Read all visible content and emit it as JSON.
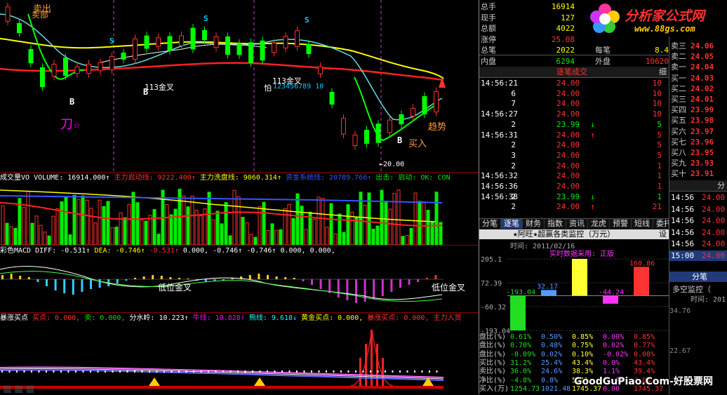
{
  "main_chart": {
    "labels": {
      "top_sell": "卖出",
      "top_sell2": "卖部",
      "knife": "刀☆",
      "jincha1": "113金叉",
      "jincha2": "113金叉",
      "buy1": "B",
      "buy2": "B",
      "buy3": "B",
      "sell1": "S",
      "sell2": "S",
      "sell3": "S",
      "buy_in": "买入",
      "trend": "趋势",
      "low_mark": "←20.00",
      "seq": "123456789 10",
      "pa": "怕"
    }
  },
  "volume_header": {
    "name": "成交量VO",
    "volume": "VOLUME: 16914.000↑",
    "start": "主力启动线: 9222.400↑",
    "wash": "主力洗盘线: 9060.314↑",
    "sys": "资金系统线: 20789.766↑",
    "out": "出击: 启动: OK: CON"
  },
  "macd_header": {
    "name": "彩色MACD",
    "diff": "DIFF: -0.531↑",
    "dea": "DEA: -0.746↑",
    "v1": "-0.531↑",
    "v2": "0.000,",
    "v3": "-0.746↑",
    "v4": "-0.746↑",
    "v5": "0.000,",
    "v6": "0.000,",
    "low1": "低位金叉",
    "low2": "低位金叉"
  },
  "bottom_header": {
    "name": "暴涨买点",
    "buy": "买点: 0.000,",
    "sell": "卖: 0.000,",
    "water": "分水岭: 10.223↑",
    "bull": "牛线: 10.828↑",
    "bear": "熊线: 9.618↓",
    "gold": "黄金买点: 0.000,",
    "boom": "暴涨买点: 0.000,",
    "main": "主力入货"
  },
  "quote_table": {
    "rows": [
      {
        "label": "总手",
        "value": "16914",
        "label2": "",
        "value2": ""
      },
      {
        "label": "现手",
        "value": "127",
        "label2": "",
        "value2": ""
      },
      {
        "label": "总额",
        "value": "4022",
        "label2": "",
        "value2": ""
      },
      {
        "label": "涨停",
        "value": "25.08",
        "label2": "",
        "value2": ""
      },
      {
        "label": "总笔",
        "value": "2022",
        "label2": "每笔",
        "value2": "8.4"
      },
      {
        "label": "内盘",
        "value": "6294",
        "label2": "外盘",
        "value2": "10620"
      }
    ]
  },
  "order_book": {
    "sell": [
      {
        "label": "卖三",
        "price": "24.06"
      },
      {
        "label": "卖二",
        "price": "24.05"
      },
      {
        "label": "卖一",
        "price": "24.04"
      }
    ],
    "buy": [
      {
        "label": "买一",
        "price": "24.03"
      },
      {
        "label": "买二",
        "price": "24.02"
      },
      {
        "label": "买三",
        "price": "24.01"
      },
      {
        "label": "买四",
        "price": "23.99"
      },
      {
        "label": "买五",
        "price": "23.98"
      },
      {
        "label": "买六",
        "price": "23.97"
      },
      {
        "label": "买七",
        "price": "23.96"
      },
      {
        "label": "买八",
        "price": "23.95"
      },
      {
        "label": "买九",
        "price": "23.93"
      },
      {
        "label": "买十",
        "price": "23.91"
      }
    ]
  },
  "brand": {
    "name": "分析家公式网",
    "url": "www.88gs.com"
  },
  "tick_section": {
    "title": "逐笔成交",
    "title_right": "细",
    "rows": [
      {
        "time": "14:56:21",
        "price": "24.00",
        "dir": "",
        "vol": "10"
      },
      {
        "time": "",
        "price": "24.00",
        "dir": "",
        "vol": "10"
      },
      {
        "time": "",
        "price": "24.00",
        "dir": "",
        "vol": "10"
      },
      {
        "time": "14:56:27",
        "price": "24.00",
        "dir": "",
        "vol": "10"
      },
      {
        "time": "",
        "price": "23.99",
        "dir": "↓",
        "vol": "5"
      },
      {
        "time": "14:56:31",
        "price": "24.00",
        "dir": "↑",
        "vol": "5"
      },
      {
        "time": "",
        "price": "24.00",
        "dir": "",
        "vol": "5"
      },
      {
        "time": "",
        "price": "24.00",
        "dir": "",
        "vol": "5"
      },
      {
        "time": "",
        "price": "24.00",
        "dir": "",
        "vol": "1"
      },
      {
        "time": "14:56:32",
        "price": "24.00",
        "dir": "",
        "vol": "1"
      },
      {
        "time": "14:56:36",
        "price": "24.00",
        "dir": "",
        "vol": "1"
      },
      {
        "time": "14:56:38",
        "price": "23.99",
        "dir": "↓",
        "vol": "1"
      },
      {
        "time": "",
        "price": "24.00",
        "dir": "↑",
        "vol": "21"
      }
    ],
    "vols_left": [
      "",
      "6",
      "7",
      "",
      "2",
      "",
      "2",
      "3",
      "2",
      "",
      "",
      "2",
      "2"
    ]
  },
  "tabs": [
    "分笔",
    "逐笔",
    "财务",
    "指数",
    "资讯",
    "龙虎",
    "预警",
    "短线",
    "委托"
  ],
  "monitor": {
    "title": "★阿旺★超赢各类监控（万元）",
    "title_right": "设",
    "date": "时间: 2011/02/16",
    "subtitle": "实时数据采用: 正版",
    "y_labels": [
      "205.1",
      "72.39",
      "-60.32",
      "-193.04"
    ],
    "bars": [
      {
        "label": "-193.04",
        "value": -193.04,
        "color": "#22dd22"
      },
      {
        "label": "32.17",
        "value": 32.17,
        "color": "#5599ff"
      },
      {
        "label": "",
        "value": 205.1,
        "color": "#ffff33"
      },
      {
        "label": "-44.24",
        "value": -44.24,
        "color": "#ff33ff"
      },
      {
        "label": "160.86",
        "value": 160.86,
        "color": "#ff3333"
      }
    ],
    "stats": [
      {
        "label": "盘比(%)",
        "vals": [
          "0.61%",
          "0.50%",
          "0.85%",
          "0.00%",
          "0.85%"
        ]
      },
      {
        "label": "盘比(%)",
        "vals": [
          "0.70%",
          "0.48%",
          "0.75%",
          "0.02%",
          "0.77%"
        ]
      },
      {
        "label": "盘比(%)",
        "vals": [
          "-0.09%",
          "0.02%",
          "0.10%",
          "-0.02%",
          "0.08%"
        ]
      },
      {
        "label": "买比(%)",
        "vals": [
          "31.2%",
          "25.4%",
          "43.4%",
          "0.0%",
          "43.4%"
        ]
      },
      {
        "label": "卖比(%)",
        "vals": [
          "36.0%",
          "24.6%",
          "38.3%",
          "1.1%",
          "39.4%"
        ]
      },
      {
        "label": "净比(%)",
        "vals": [
          "-4.8%",
          "0.8%",
          "5.1%",
          "-1.1%",
          "4.0%"
        ]
      },
      {
        "label": "买入(万)",
        "vals": [
          "1254.73",
          "1021.48",
          "1745.37",
          "0.00",
          "1745.37"
        ]
      }
    ]
  },
  "right_strip": {
    "sell_header": "卖一",
    "sell_header_price": "24.04",
    "side_title": "分",
    "times": [
      "14:56",
      "14:56",
      "14:56",
      "14:56",
      "14:56",
      "15:00"
    ],
    "prices": [
      "24.00",
      "24.00",
      "24.00",
      "24.00",
      "24.00",
      "24.00"
    ],
    "fenbi": "分笔",
    "duokong": "多空监控（",
    "time_label": "时间: 201",
    "y1": "34.76",
    "y2": "22.67"
  },
  "watermark": "GoodGuPiao.Com-好股票网",
  "chart_data": {
    "type": "bar",
    "title": "★阿旺★超赢各类监控（万元）",
    "categories": [
      "",
      "",
      "",
      "",
      ""
    ],
    "values": [
      -193.04,
      32.17,
      205.1,
      -44.24,
      160.86
    ],
    "ylim": [
      -193.04,
      205.1
    ]
  }
}
